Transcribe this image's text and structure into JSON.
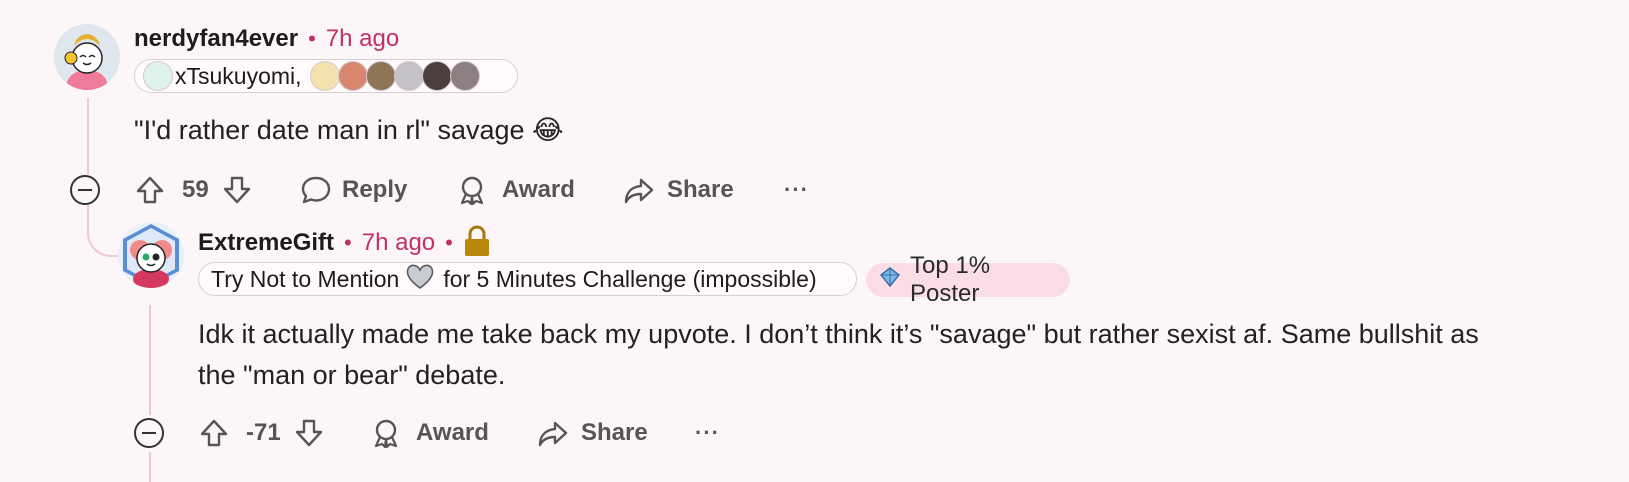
{
  "comment1": {
    "username": "nerdyfan4ever",
    "separator": "•",
    "time": "7h ago",
    "flair_text": "xTsukuyomi,",
    "body": "\"I'd rather date man in rl\" savage 😂",
    "votes": "59",
    "reply_label": "Reply",
    "award_label": "Award",
    "share_label": "Share",
    "more_label": "···"
  },
  "comment2": {
    "username": "ExtremeGift",
    "separator": "•",
    "time": "7h ago",
    "separator2": "•",
    "flair_text_before": "Try Not to Mention",
    "flair_text_after": "for 5 Minutes Challenge (impossible)",
    "badge_text": "Top 1% Poster",
    "body": "Idk it actually made me take back my upvote. I don’t think it’s \"savage\" but rather sexist af. Same bullshit as the \"man or bear\" debate.",
    "votes": "-71",
    "award_label": "Award",
    "share_label": "Share",
    "more_label": "···"
  },
  "colors": {
    "accent": "#c0325f",
    "thread_line": "#f2c6d3",
    "background": "#fdf6f8",
    "badge_bg": "#fbdde6"
  },
  "icons": [
    "upvote-icon",
    "downvote-icon",
    "reply-icon",
    "award-icon",
    "share-icon",
    "more-icon",
    "collapse-icon",
    "lock-icon",
    "diamond-icon"
  ]
}
